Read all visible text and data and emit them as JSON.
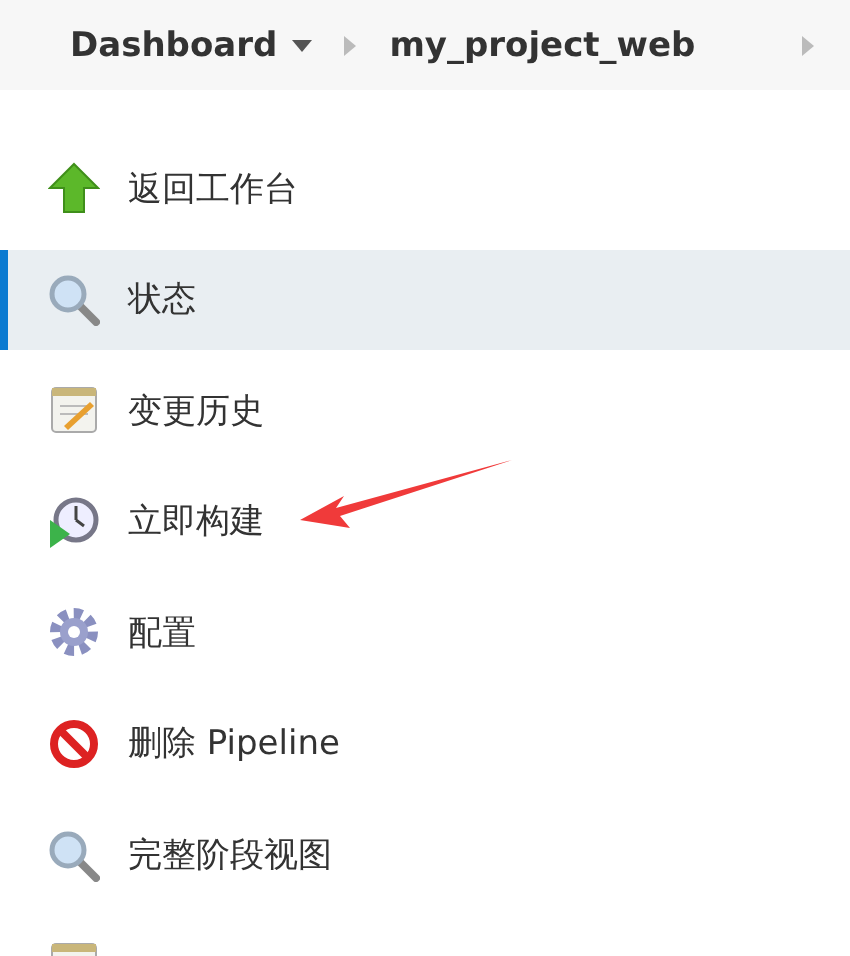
{
  "breadcrumb": [
    {
      "label": "Dashboard",
      "dropdown": true
    },
    {
      "label": "my_project_web",
      "dropdown": false
    }
  ],
  "sidebar": {
    "items": [
      {
        "label": "返回工作台",
        "kind": "up-arrow",
        "selected": false
      },
      {
        "label": "状态",
        "kind": "magnifier",
        "selected": true
      },
      {
        "label": "变更历史",
        "kind": "notepad",
        "selected": false
      },
      {
        "label": "立即构建",
        "kind": "clock-play",
        "selected": false
      },
      {
        "label": "配置",
        "kind": "gear",
        "selected": false
      },
      {
        "label": "删除 Pipeline",
        "kind": "no-sign",
        "selected": false
      },
      {
        "label": "完整阶段视图",
        "kind": "magnifier",
        "selected": false
      },
      {
        "kind": "notepad",
        "selected": false
      }
    ]
  }
}
